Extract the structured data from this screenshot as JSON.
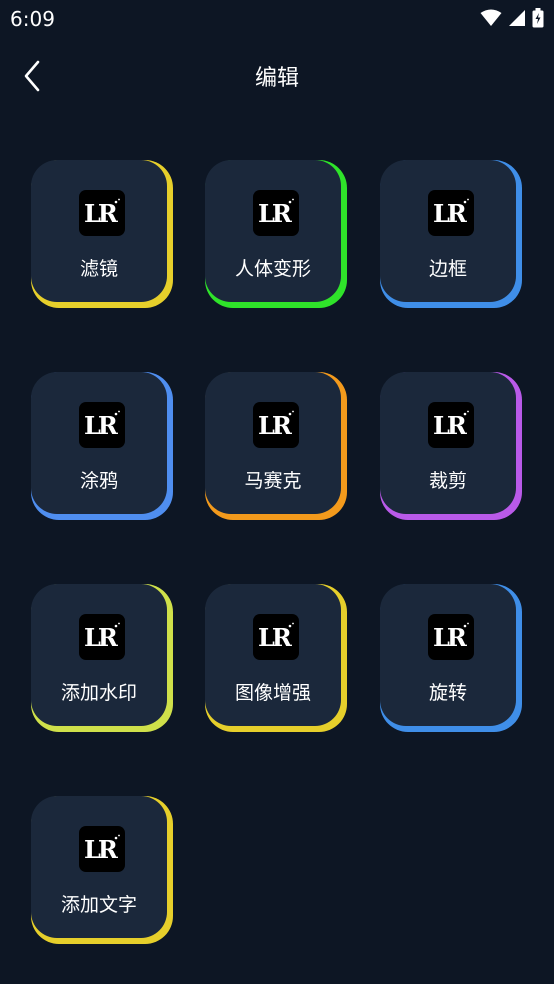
{
  "status": {
    "time": "6:09"
  },
  "header": {
    "title": "编辑"
  },
  "colors": {
    "background": "#0d1624",
    "tile": "#1b283b"
  },
  "tools": [
    {
      "label": "滤镜",
      "accent": "#e6cf2b"
    },
    {
      "label": "人体变形",
      "accent": "#2fe32a"
    },
    {
      "label": "边框",
      "accent": "#3f8ee8"
    },
    {
      "label": "涂鸦",
      "accent": "#4f8ef0"
    },
    {
      "label": "马赛克",
      "accent": "#f39a1c"
    },
    {
      "label": "裁剪",
      "accent": "#b95ae9"
    },
    {
      "label": "添加水印",
      "accent": "#cfe04a"
    },
    {
      "label": "图像增强",
      "accent": "#e6cf2b"
    },
    {
      "label": "旋转",
      "accent": "#3f8ee8"
    },
    {
      "label": "添加文字",
      "accent": "#e6cf2b"
    }
  ]
}
